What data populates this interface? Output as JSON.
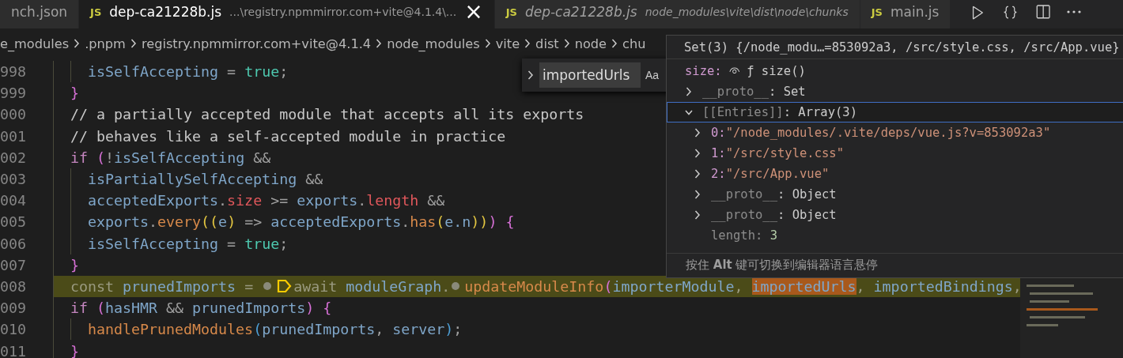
{
  "tabs": [
    {
      "label": "nch.json",
      "selected": false,
      "italic": false,
      "closable": false
    },
    {
      "icon": "JS",
      "label": "dep-ca21228b.js",
      "description": "...\\registry.npmmirror.com+vite@4.1.4\\...",
      "selected": true,
      "italic": false,
      "closable": true,
      "close": "×"
    },
    {
      "icon": "JS",
      "label": "dep-ca21228b.js",
      "description": "node_modules\\vite\\dist\\node\\chunks",
      "selected": false,
      "italic": true,
      "closable": false
    },
    {
      "icon": "JS",
      "label": "main.js",
      "selected": false,
      "italic": false,
      "closable": false
    }
  ],
  "breadcrumbs": [
    "e_modules",
    ".pnpm",
    "registry.npmmirror.com+vite@4.1.4",
    "node_modules",
    "vite",
    "dist",
    "node",
    "chu"
  ],
  "find_widget": {
    "value": "importedUrls",
    "toggle": "Aa"
  },
  "lines": [
    {
      "number": "998",
      "kind": "nested",
      "current": false,
      "tokens": [
        {
          "kind": "var",
          "text": "isSelfAccepting"
        },
        {
          "kind": "op",
          "text": " = "
        },
        {
          "kind": "bool",
          "text": "true"
        },
        {
          "kind": "op",
          "text": ";"
        }
      ]
    },
    {
      "number": "999",
      "kind": "top",
      "current": false,
      "tokens": [
        {
          "kind": "brace",
          "text": "}"
        }
      ]
    },
    {
      "number": "000",
      "kind": "top",
      "current": false,
      "tokens": [
        {
          "kind": "comment",
          "text": "// a partially accepted module that accepts all its exports"
        }
      ]
    },
    {
      "number": "001",
      "kind": "top",
      "current": false,
      "tokens": [
        {
          "kind": "comment",
          "text": "// behaves like a self-accepted module in practice"
        }
      ]
    },
    {
      "number": "002",
      "kind": "top",
      "current": false,
      "tokens": [
        {
          "kind": "keyword",
          "text": "if"
        },
        {
          "kind": "brace",
          "text": " ("
        },
        {
          "kind": "op",
          "text": "!"
        },
        {
          "kind": "var",
          "text": "isSelfAccepting"
        },
        {
          "kind": "op",
          "text": " &&"
        }
      ]
    },
    {
      "number": "003",
      "kind": "nested",
      "current": false,
      "tokens": [
        {
          "kind": "var",
          "text": "isPartiallySelfAccepting"
        },
        {
          "kind": "op",
          "text": " &&"
        }
      ]
    },
    {
      "number": "004",
      "kind": "nested",
      "current": false,
      "tokens": [
        {
          "kind": "var",
          "text": "acceptedExports"
        },
        {
          "kind": "op",
          "text": "."
        },
        {
          "kind": "prop",
          "text": "size"
        },
        {
          "kind": "op",
          "text": " >= "
        },
        {
          "kind": "var",
          "text": "exports"
        },
        {
          "kind": "op",
          "text": "."
        },
        {
          "kind": "prop",
          "text": "length"
        },
        {
          "kind": "op",
          "text": " &&"
        }
      ]
    },
    {
      "number": "005",
      "kind": "nested",
      "current": false,
      "tokens": [
        {
          "kind": "var",
          "text": "exports"
        },
        {
          "kind": "op",
          "text": "."
        },
        {
          "kind": "fn",
          "text": "every"
        },
        {
          "kind": "paren",
          "text": "(("
        },
        {
          "kind": "var",
          "text": "e"
        },
        {
          "kind": "paren",
          "text": ")"
        },
        {
          "kind": "op",
          "text": " => "
        },
        {
          "kind": "var",
          "text": "acceptedExports"
        },
        {
          "kind": "op",
          "text": "."
        },
        {
          "kind": "fn",
          "text": "has"
        },
        {
          "kind": "paren",
          "text": "("
        },
        {
          "kind": "var",
          "text": "e.n"
        },
        {
          "kind": "paren",
          "text": "))"
        },
        {
          "kind": "brace",
          "text": ") {"
        }
      ]
    },
    {
      "number": "006",
      "kind": "nested",
      "current": false,
      "tokens": [
        {
          "kind": "var",
          "text": "isSelfAccepting"
        },
        {
          "kind": "op",
          "text": " = "
        },
        {
          "kind": "bool",
          "text": "true"
        },
        {
          "kind": "op",
          "text": ";"
        }
      ]
    },
    {
      "number": "007",
      "kind": "top",
      "current": false,
      "tokens": [
        {
          "kind": "brace",
          "text": "}"
        }
      ]
    },
    {
      "number": "008",
      "kind": "top",
      "current": true,
      "tokens": [
        {
          "kind": "keyword",
          "text": "const"
        },
        {
          "kind": "var",
          "text": " prunedImports"
        },
        {
          "kind": "op",
          "text": " = "
        },
        {
          "kind": "breakpoint"
        },
        {
          "kind": "stop"
        },
        {
          "kind": "keyword",
          "text": "await"
        },
        {
          "kind": "var",
          "text": " moduleGraph"
        },
        {
          "kind": "op",
          "text": "."
        },
        {
          "kind": "breakpoint"
        },
        {
          "kind": "fn",
          "text": "updateModuleInfo"
        },
        {
          "kind": "brace",
          "text": "("
        },
        {
          "kind": "var",
          "text": "importerModule"
        },
        {
          "kind": "op",
          "text": ", "
        },
        {
          "kind": "match",
          "text": "importedUrls"
        },
        {
          "kind": "op",
          "text": ", "
        },
        {
          "kind": "var",
          "text": "importedBindings"
        },
        {
          "kind": "op",
          "text": ","
        }
      ]
    },
    {
      "number": "009",
      "kind": "top",
      "current": false,
      "tokens": [
        {
          "kind": "keyword",
          "text": "if"
        },
        {
          "kind": "brace",
          "text": " ("
        },
        {
          "kind": "var",
          "text": "hasHMR"
        },
        {
          "kind": "op",
          "text": " && "
        },
        {
          "kind": "var",
          "text": "prunedImports"
        },
        {
          "kind": "brace",
          "text": ") {"
        }
      ]
    },
    {
      "number": "010",
      "kind": "nested",
      "current": false,
      "tokens": [
        {
          "kind": "fn",
          "text": "handlePrunedModules"
        },
        {
          "kind": "paren2",
          "text": "("
        },
        {
          "kind": "var",
          "text": "prunedImports"
        },
        {
          "kind": "op",
          "text": ", "
        },
        {
          "kind": "var",
          "text": "server"
        },
        {
          "kind": "paren2",
          "text": ")"
        },
        {
          "kind": "op",
          "text": ";"
        }
      ]
    },
    {
      "number": "011",
      "kind": "top",
      "current": false,
      "tokens": [
        {
          "kind": "brace",
          "text": "}"
        }
      ]
    }
  ],
  "hover": {
    "header": "Set(3) {/node_modu…=853092a3, /src/style.css, /src/App.vue}",
    "items": [
      {
        "kind": "getter",
        "name": "size:",
        "internal": false,
        "value": {
          "kind": "plain",
          "text": "ƒ size()"
        }
      },
      {
        "kind": "node",
        "name": "__proto__",
        "internal": true,
        "value": {
          "kind": "plain",
          "text": ": Set"
        },
        "expanded": false,
        "selected": false
      },
      {
        "kind": "node",
        "name": "[[Entries]]",
        "internal": true,
        "value": {
          "kind": "plain",
          "text": ": Array(3)"
        },
        "expanded": true,
        "selected": true,
        "children": [
          {
            "kind": "node",
            "name": "0:",
            "internal": false,
            "value": {
              "kind": "string",
              "text": "\"/node_modules/.vite/deps/vue.js?v=853092a3\""
            },
            "expanded": false,
            "selected": false
          },
          {
            "kind": "node",
            "name": "1:",
            "internal": false,
            "value": {
              "kind": "string",
              "text": "\"/src/style.css\""
            },
            "expanded": false,
            "selected": false
          },
          {
            "kind": "node",
            "name": "2:",
            "internal": false,
            "value": {
              "kind": "string",
              "text": "\"/src/App.vue\""
            },
            "expanded": false,
            "selected": false
          },
          {
            "kind": "node",
            "name": "__proto__",
            "internal": true,
            "value": {
              "kind": "plain",
              "text": ": Object"
            },
            "expanded": false,
            "selected": false
          },
          {
            "kind": "node",
            "name": "__proto__",
            "internal": true,
            "value": {
              "kind": "plain",
              "text": ": Object"
            },
            "expanded": false,
            "selected": false
          },
          {
            "kind": "leaf",
            "name": "length:",
            "internal": true,
            "value": {
              "kind": "number",
              "text": "3"
            }
          }
        ]
      }
    ],
    "footer": "按住 **Alt** 键可切换到编辑器语言悬停"
  }
}
